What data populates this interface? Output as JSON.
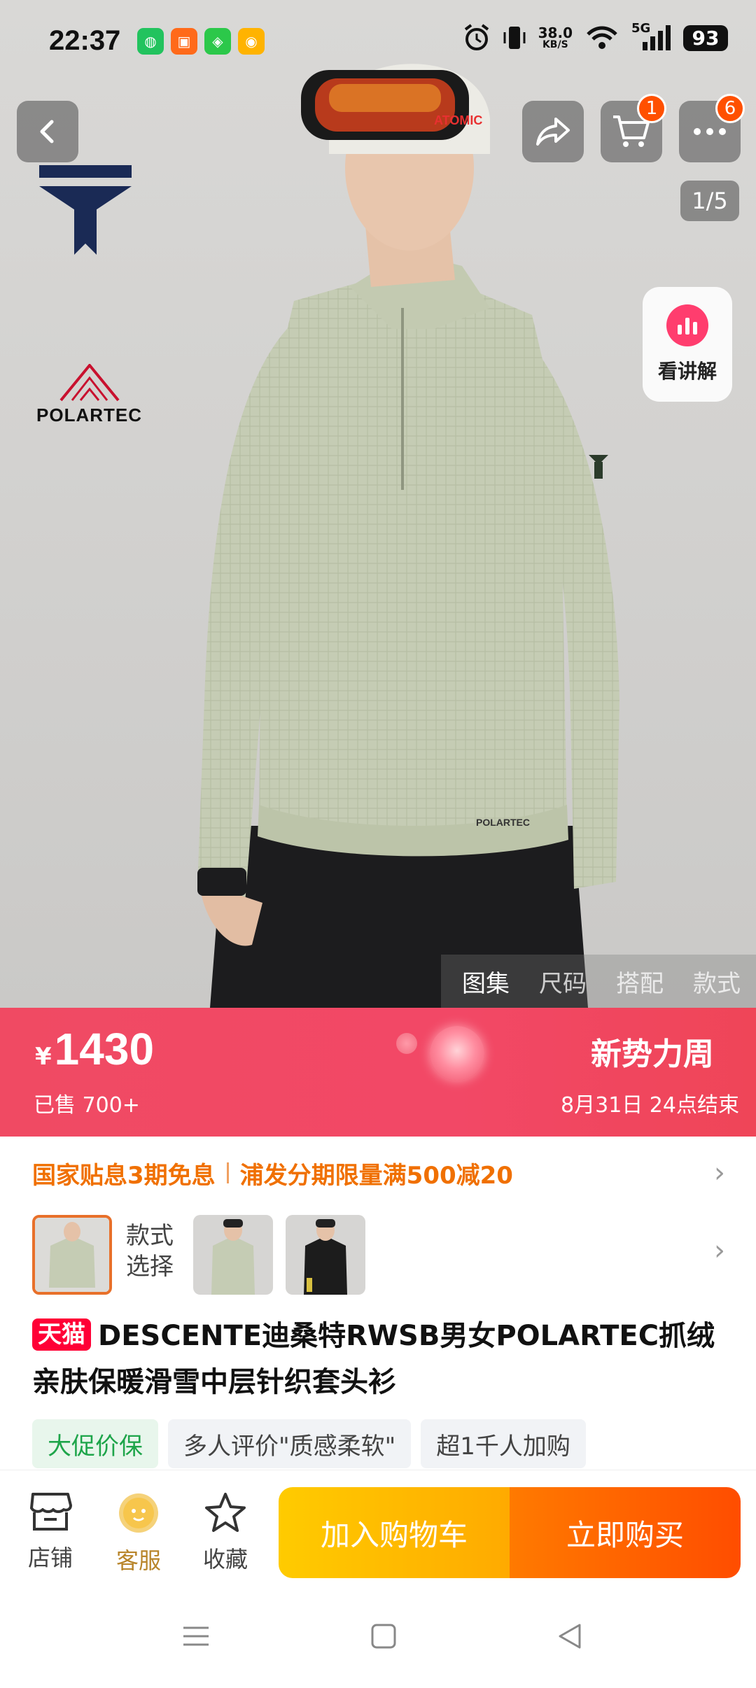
{
  "status_bar": {
    "time": "22:37",
    "speed_value": "38.0",
    "speed_unit": "KB/S",
    "network": "5G",
    "battery": "93",
    "app_icons": [
      "wechat-icon",
      "taobao-icon",
      "wechat-work-icon",
      "weibo-icon"
    ]
  },
  "top_nav": {
    "cart_badge": "1",
    "more_badge": "6",
    "page_indicator": "1/5",
    "explain_label": "看讲解"
  },
  "hero": {
    "brand_logo": "descente-logo",
    "sub_logo": "POLARTEC",
    "goggle_text": "ATOMIC",
    "gallery_tabs": [
      "图集",
      "尺码",
      "搭配",
      "款式"
    ],
    "active_tab": "图集"
  },
  "price_bar": {
    "currency": "¥",
    "price": "1430",
    "sold": "已售 700+",
    "promo_title": "新势力周",
    "promo_end": "8月31日 24点结束",
    "color": "#f04a63"
  },
  "subsidy": {
    "left": "国家贴息3期免息",
    "right": "浦发分期限量满500减20"
  },
  "styles": {
    "label_line1": "款式",
    "label_line2": "选择"
  },
  "product": {
    "badge": "天猫",
    "title": "DESCENTE迪桑特RWSB男女POLARTEC抓绒亲肤保暖滑雪中层针织套头衫"
  },
  "tags": [
    "大促价保",
    "多人评价\"质感柔软\"",
    "超1千人加购"
  ],
  "actions": {
    "shop": "店铺",
    "service": "客服",
    "favorite": "收藏",
    "add_to_cart": "加入购物车",
    "buy_now": "立即购买"
  }
}
